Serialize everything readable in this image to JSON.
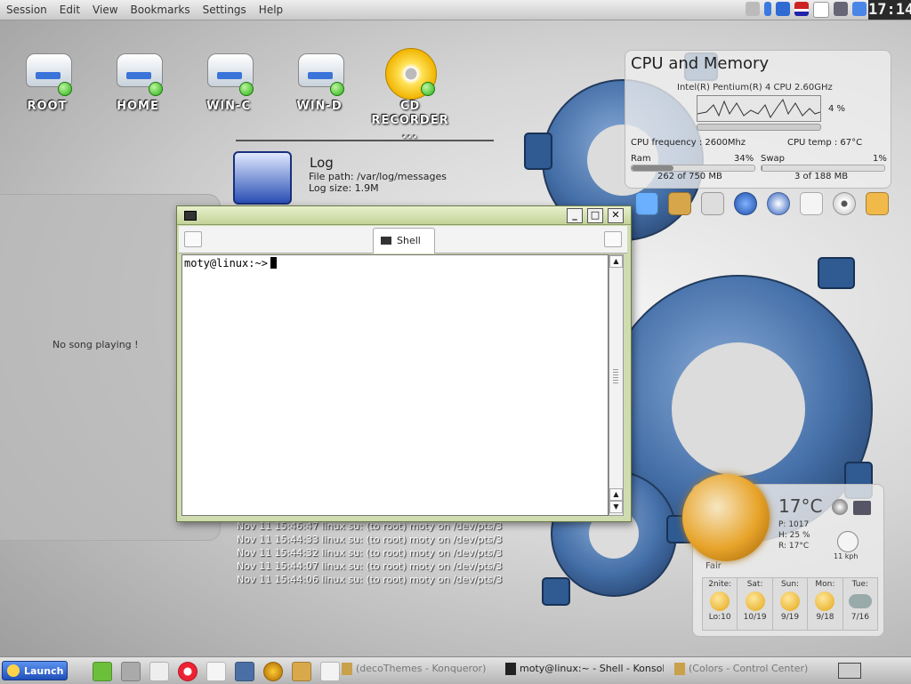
{
  "menubar": {
    "items": [
      "Session",
      "Edit",
      "View",
      "Bookmarks",
      "Settings",
      "Help"
    ],
    "clock": "17:14"
  },
  "tray_icons": [
    "usb-icon",
    "arrow-icon",
    "updater-icon",
    "flag-icon",
    "clipboard-icon",
    "printer-icon",
    "volume-icon"
  ],
  "desktop_icons": [
    {
      "label": "ROOT",
      "type": "drive"
    },
    {
      "label": "HOME",
      "type": "drive"
    },
    {
      "label": "WIN-C",
      "type": "drive"
    },
    {
      "label": "WIN-D",
      "type": "drive"
    },
    {
      "label": "CD RECORDER ...",
      "type": "cd"
    }
  ],
  "log_widget": {
    "title": "Log",
    "file_path": "File path: /var/log/messages",
    "size": "Log size: 1.9M"
  },
  "music_widget": {
    "status": "No song playing !"
  },
  "log_lines": [
    "Nov 11 15:46:47 linux su: (to root) moty on /dev/pts/3",
    "Nov 11 15:44:33 linux su: (to root) moty on /dev/pts/3",
    "Nov 11 15:44:32 linux su: (to root) moty on /dev/pts/3",
    "Nov 11 15:44:07 linux su: (to root) moty on /dev/pts/3",
    "Nov 11 15:44:06 linux su: (to root) moty on /dev/pts/3"
  ],
  "cpu_widget": {
    "title": "CPU and Memory",
    "model": "Intel(R) Pentium(R) 4 CPU 2.60GHz",
    "cpu_percent": "4 %",
    "frequency": "CPU frequency : 2600Mhz",
    "temp": "CPU temp : 67°C",
    "ram_label": "Ram",
    "ram_percent": "34%",
    "ram_value": "262 of 750 MB",
    "ram_fraction": 0.34,
    "swap_label": "Swap",
    "swap_percent": "1%",
    "swap_value": "3 of 188 MB",
    "swap_fraction": 0.01
  },
  "quick_icons": [
    "computer-icon",
    "tools-icon",
    "drive-icon",
    "network-icon",
    "clock-icon",
    "document-icon",
    "cd-icon",
    "trash-icon"
  ],
  "weather": {
    "temp": "17°C",
    "pressure": "P: 1017",
    "humidity": "H: 25 %",
    "real": "R: 17°C",
    "wind": "11 kph",
    "condition": "Fair",
    "forecast": [
      {
        "day": "2nite:",
        "temps": "Lo:10",
        "icon": "moon-icon"
      },
      {
        "day": "Sat:",
        "temps": "10/19",
        "icon": "sun-icon"
      },
      {
        "day": "Sun:",
        "temps": "9/19",
        "icon": "sun-icon"
      },
      {
        "day": "Mon:",
        "temps": "9/18",
        "icon": "sun-icon"
      },
      {
        "day": "Tue:",
        "temps": "7/16",
        "icon": "cloud-icon"
      }
    ]
  },
  "terminal": {
    "tab_label": "Shell",
    "prompt": "moty@linux:~>"
  },
  "taskbar": {
    "launch_label": "Launch",
    "quick_launch": [
      "kde-icon",
      "browser-icon",
      "mail-icon",
      "help-icon",
      "editor-icon",
      "settings-icon",
      "music-icon",
      "office-icon",
      "paint-icon"
    ],
    "tasks": [
      {
        "label": "(decoThemes - Konqueror)",
        "active": false
      },
      {
        "label": "moty@linux:~ - Shell - Konsole",
        "active": true
      },
      {
        "label": "(Colors - Control Center)",
        "active": false
      }
    ]
  }
}
